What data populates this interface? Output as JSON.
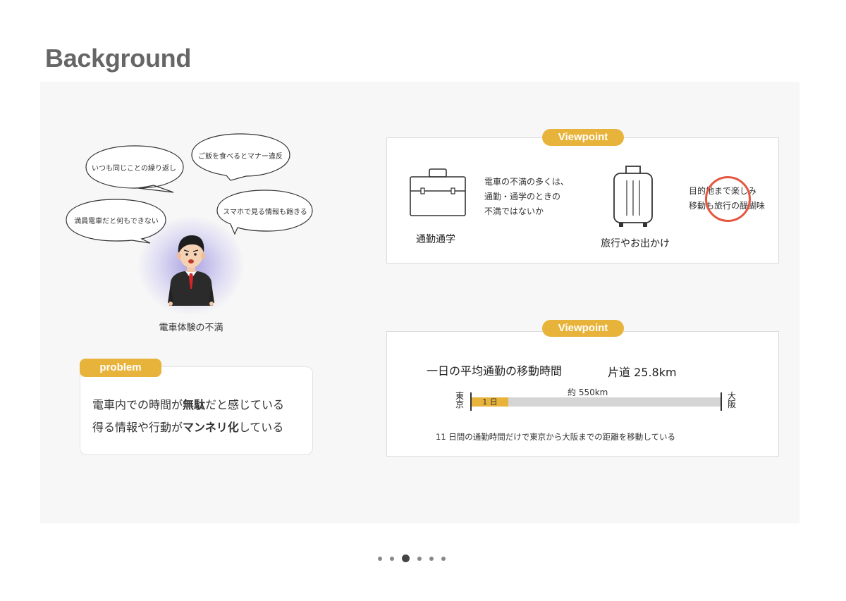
{
  "page_title": "Background",
  "bubbles": [
    {
      "text": "いつも同じことの繰り返し"
    },
    {
      "text": "ご飯を食べるとマナー違反"
    },
    {
      "text": "満員電車だと何もできない"
    },
    {
      "text": "スマホで見る情報も飽きる"
    }
  ],
  "person_caption": "電車体験の不満",
  "problem": {
    "tag": "problem",
    "line1": {
      "pre": "電車内での時間が",
      "bold": "無駄",
      "post": "だと感じている"
    },
    "line2": {
      "pre": "得る情報や行動が",
      "bold": "マンネリ化",
      "post": "している"
    }
  },
  "viewpoint1": {
    "tag": "Viewpoint",
    "commute_text": [
      "電車の不満の多くは、",
      "通勤・通学のときの",
      "不満ではないか"
    ],
    "commute_caption": "通勤通学",
    "travel_text": [
      "目的地まで楽しみ",
      "移動も旅行の醍醐味"
    ],
    "travel_caption": "旅行やお出かけ",
    "icons": [
      "briefcase-icon",
      "suitcase-icon"
    ]
  },
  "viewpoint2": {
    "tag": "Viewpoint",
    "title": "一日の平均通勤の移動時間",
    "distance": "片道 25.8km",
    "start_label": "東京",
    "end_label": "大阪",
    "day_label": "1 日",
    "total_label": "約 550km",
    "note": "11 日間の通勤時間だけで東京から大阪までの距離を移動している"
  },
  "pagination": {
    "count": 6,
    "active_index": 2
  },
  "colors": {
    "accent": "#e8b33a",
    "highlight_circle": "#e5553f",
    "panel": "#f7f7f7",
    "title": "#666666"
  }
}
